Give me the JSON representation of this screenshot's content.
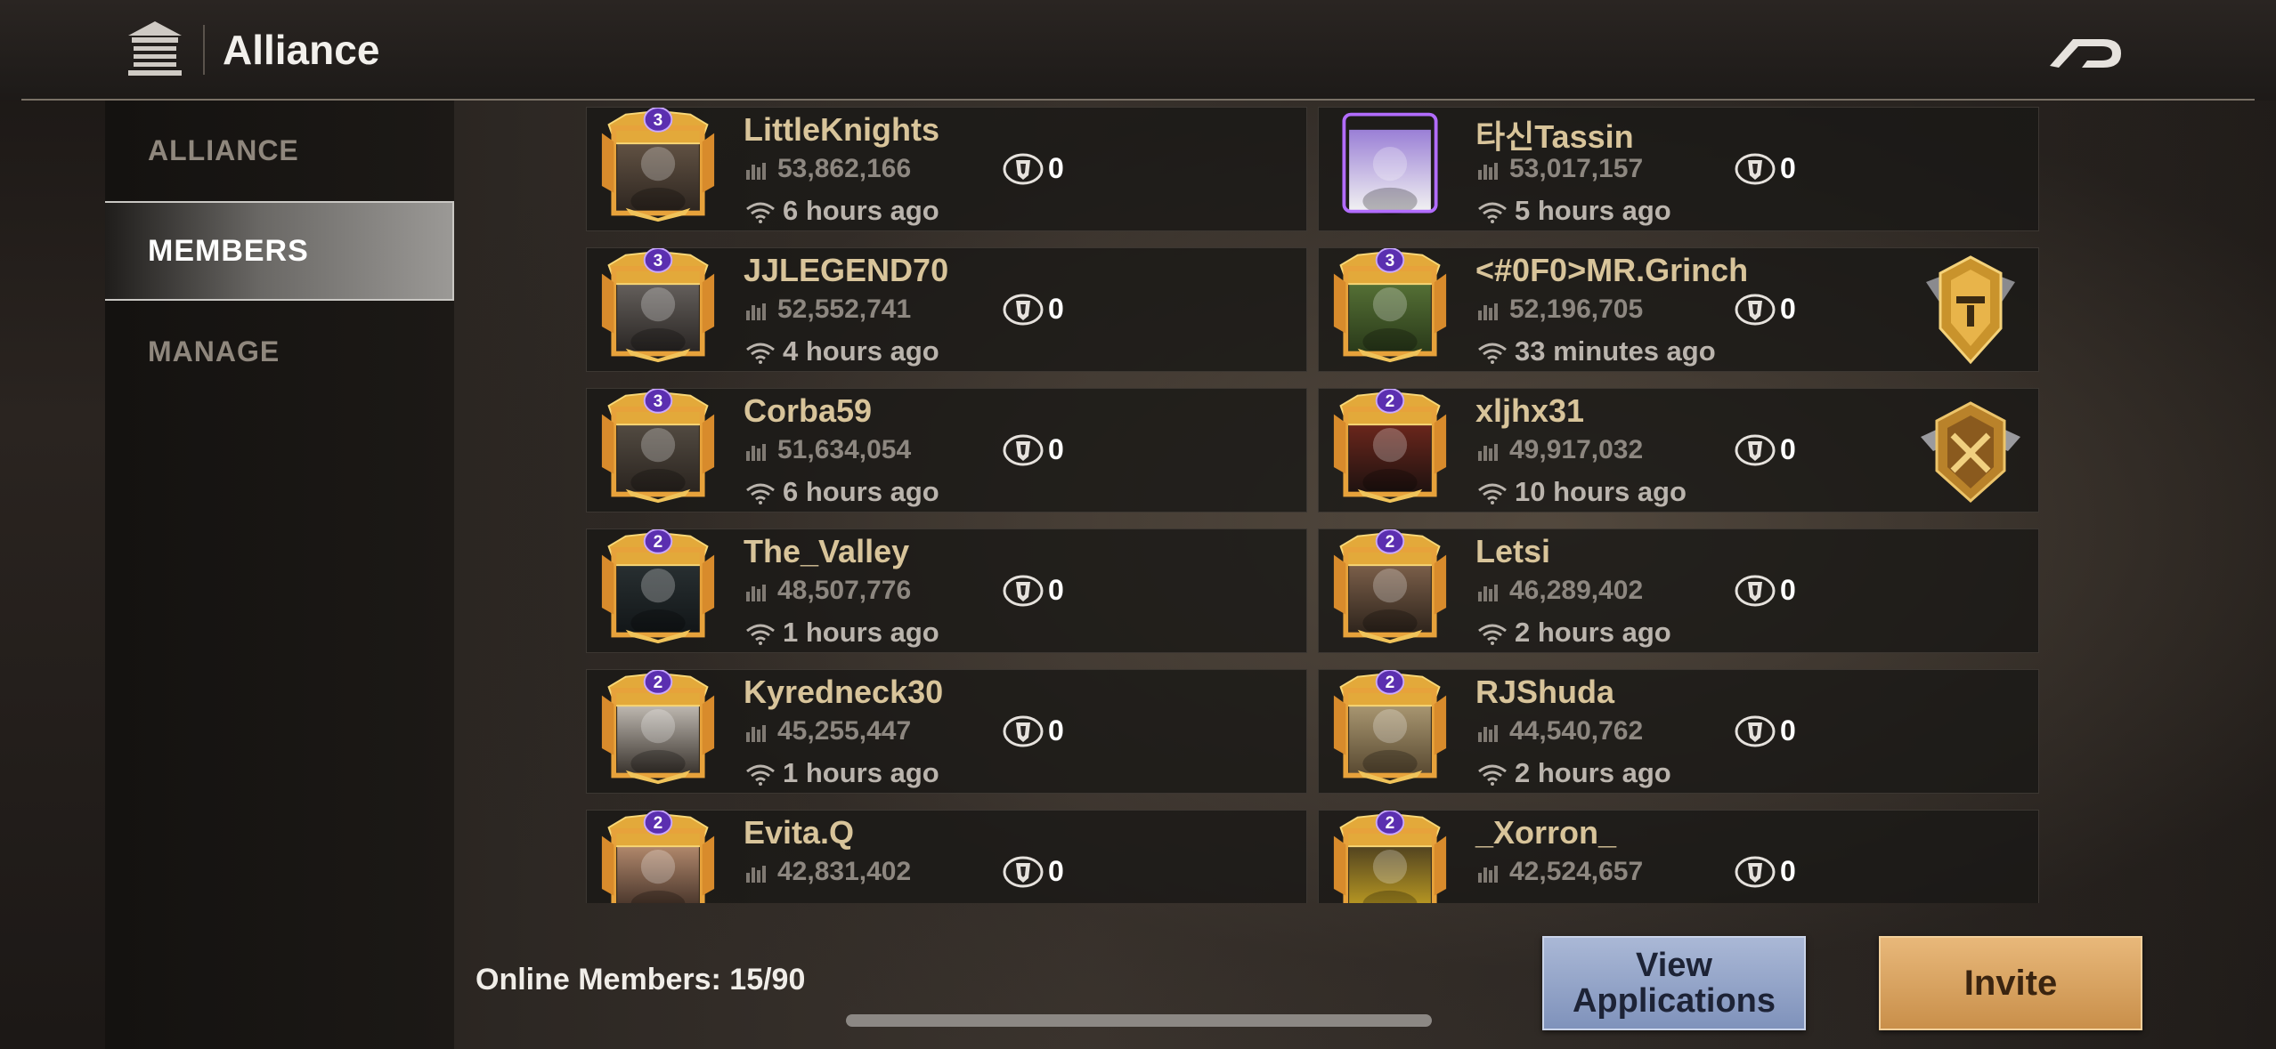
{
  "header": {
    "title": "Alliance",
    "home_icon": "alliance-building-icon",
    "back_icon": "back-arrow-icon"
  },
  "sidebar": {
    "items": [
      {
        "label": "ALLIANCE",
        "active": false
      },
      {
        "label": "MEMBERS",
        "active": true
      },
      {
        "label": "MANAGE",
        "active": false
      }
    ]
  },
  "members": [
    {
      "name": "LittleKnights",
      "power": "53,862,166",
      "kills": "0",
      "last_online": "6 hours ago",
      "rank": "3",
      "badge": ""
    },
    {
      "name": "타신Tassin",
      "power": "53,017,157",
      "kills": "0",
      "last_online": "5 hours ago",
      "rank": "",
      "badge": ""
    },
    {
      "name": "JJLEGEND70",
      "power": "52,552,741",
      "kills": "0",
      "last_online": "4 hours ago",
      "rank": "3",
      "badge": ""
    },
    {
      "name": "<#0F0>MR.Grinch",
      "power": "52,196,705",
      "kills": "0",
      "last_online": "33 minutes ago",
      "rank": "3",
      "badge": "leader"
    },
    {
      "name": "Corba59",
      "power": "51,634,054",
      "kills": "0",
      "last_online": "6 hours ago",
      "rank": "3",
      "badge": ""
    },
    {
      "name": "xljhx31",
      "power": "49,917,032",
      "kills": "0",
      "last_online": "10 hours ago",
      "rank": "2",
      "badge": "officer"
    },
    {
      "name": "The_Valley",
      "power": "48,507,776",
      "kills": "0",
      "last_online": "1 hours ago",
      "rank": "2",
      "badge": ""
    },
    {
      "name": "Letsi",
      "power": "46,289,402",
      "kills": "0",
      "last_online": "2 hours ago",
      "rank": "2",
      "badge": ""
    },
    {
      "name": "Kyredneck30",
      "power": "45,255,447",
      "kills": "0",
      "last_online": "1 hours ago",
      "rank": "2",
      "badge": ""
    },
    {
      "name": "RJShuda",
      "power": "44,540,762",
      "kills": "0",
      "last_online": "2 hours ago",
      "rank": "2",
      "badge": ""
    },
    {
      "name": "Evita.Q",
      "power": "42,831,402",
      "kills": "0",
      "last_online": "",
      "rank": "2",
      "badge": ""
    },
    {
      "name": "_Xorron_",
      "power": "42,524,657",
      "kills": "0",
      "last_online": "",
      "rank": "2",
      "badge": ""
    }
  ],
  "footer": {
    "online_members": "Online Members: 15/90",
    "view_applications_label": "View Applications",
    "invite_label": "Invite"
  },
  "colors": {
    "name_gold": "#d8c49a",
    "invite_orange": "#d9a05e",
    "applications_blue": "#93a5c9"
  }
}
